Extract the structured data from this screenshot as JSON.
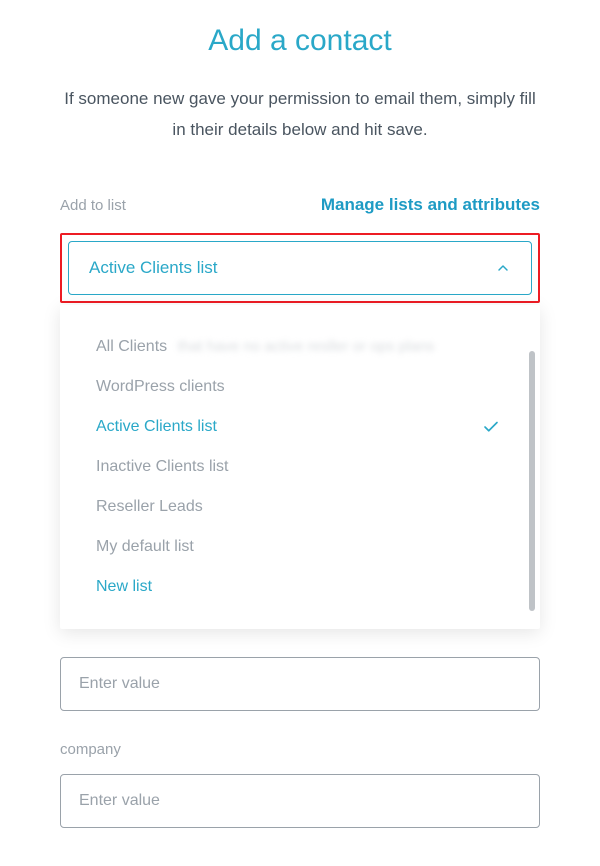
{
  "title": "Add a contact",
  "description": "If someone new gave your permission to email them, simply fill in their details below and hit save.",
  "list_section": {
    "label": "Add to list",
    "manage_link": "Manage lists and attributes",
    "selected": "Active Clients list",
    "options": [
      {
        "label": "All Clients",
        "selected": false,
        "blurred_suffix": "that have no active resller or ops plans"
      },
      {
        "label": "WordPress clients",
        "selected": false
      },
      {
        "label": "Active Clients list",
        "selected": true
      },
      {
        "label": "Inactive Clients list",
        "selected": false
      },
      {
        "label": "Reseller Leads",
        "selected": false
      },
      {
        "label": "My default list",
        "selected": false
      }
    ],
    "new_list_label": "New list"
  },
  "input1_placeholder": "Enter value",
  "company": {
    "label": "company",
    "placeholder": "Enter value"
  }
}
